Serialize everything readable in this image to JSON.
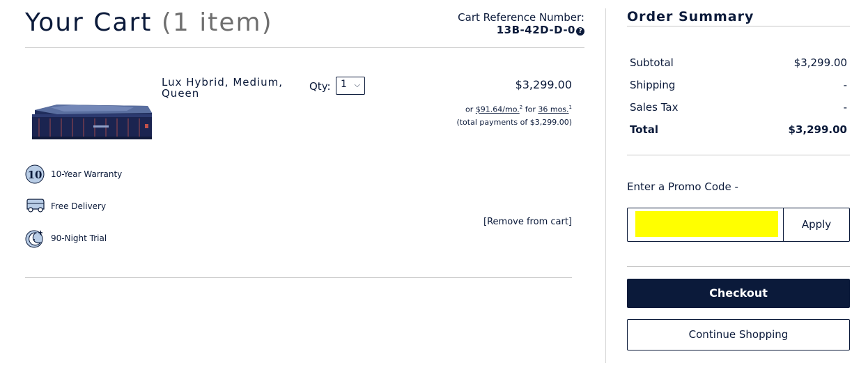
{
  "cart": {
    "title": "Your Cart",
    "item_count": "(1 item)",
    "reference_label": "Cart Reference Number:",
    "reference_value": "13B-42D-D-0",
    "help_icon": "question-circle-icon"
  },
  "item": {
    "name": "Lux Hybrid, Medium, Queen",
    "qty_label": "Qty:",
    "qty_value": "1",
    "price": "$3,299.00",
    "finance_prefix": "or",
    "finance_monthly": "$91.64/mo.",
    "finance_monthly_sup": "2",
    "finance_for": "for",
    "finance_term": "36 mos.",
    "finance_term_sup": "1",
    "finance_total": "(total payments of $3,299.00)",
    "remove_label": "[Remove from cart]",
    "image": "mattress-image"
  },
  "features": [
    {
      "icon": "warranty-10-icon",
      "label": "10-Year Warranty"
    },
    {
      "icon": "delivery-truck-icon",
      "label": "Free Delivery"
    },
    {
      "icon": "moon-trial-icon",
      "label": "90-Night Trial"
    }
  ],
  "summary": {
    "title": "Order Summary",
    "rows": [
      {
        "label": "Subtotal",
        "value": "$3,299.00"
      },
      {
        "label": "Shipping",
        "value": "-"
      },
      {
        "label": "Sales Tax",
        "value": "-"
      },
      {
        "label": "Total",
        "value": "$3,299.00"
      }
    ],
    "promo_label": "Enter a Promo Code -",
    "promo_value": "",
    "apply_label": "Apply",
    "checkout_label": "Checkout",
    "continue_label": "Continue Shopping"
  },
  "colors": {
    "navy": "#0b1a3a",
    "promo_highlight": "#ffff00",
    "divider": "#c8c8c8"
  }
}
